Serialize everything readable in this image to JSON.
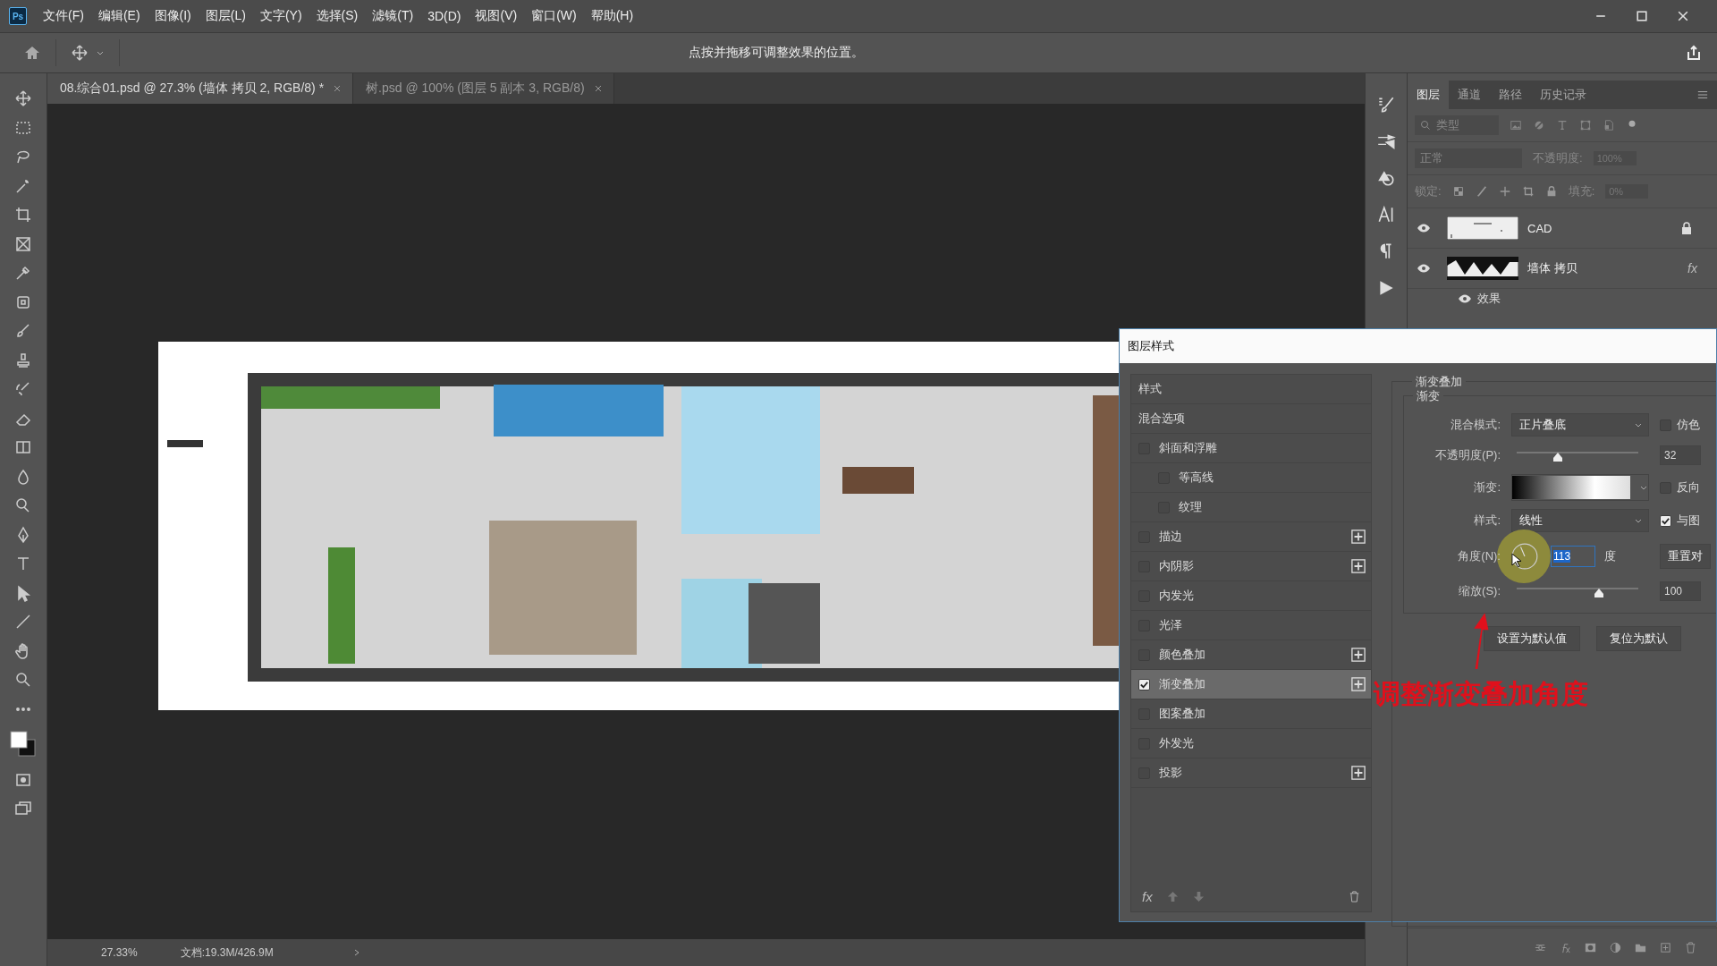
{
  "app_logo": "Ps",
  "menu_bar": {
    "items": [
      "文件(F)",
      "编辑(E)",
      "图像(I)",
      "图层(L)",
      "文字(Y)",
      "选择(S)",
      "滤镜(T)",
      "3D(D)",
      "视图(V)",
      "窗口(W)",
      "帮助(H)"
    ]
  },
  "options_bar": {
    "hint": "点按并拖移可调整效果的位置。"
  },
  "document_tabs": [
    {
      "label": "08.综合01.psd @ 27.3% (墙体 拷贝 2, RGB/8) *",
      "selected": true
    },
    {
      "label": "树.psd @ 100% (图层 5 副本 3, RGB/8)",
      "selected": false
    }
  ],
  "status_bar": {
    "zoom": "27.33%",
    "doc_info": "文档:19.3M/426.9M"
  },
  "layers_panel": {
    "tabs": [
      {
        "label": "图层",
        "selected": true
      },
      {
        "label": "通道",
        "selected": false
      },
      {
        "label": "路径",
        "selected": false
      },
      {
        "label": "历史记录",
        "selected": false
      }
    ],
    "filter": "类型",
    "blend_mode": "正常",
    "opacity_label": "不透明度:",
    "opacity": "100%",
    "lock_label": "锁定:",
    "fill_label": "填充:",
    "fill": "0%",
    "layers": [
      {
        "name": "CAD",
        "visible": true,
        "locked": true,
        "kind": "lines"
      },
      {
        "name": "墙体 拷贝",
        "visible": true,
        "locked": false,
        "kind": "walls",
        "badge": "fx",
        "effects_label": "效果"
      }
    ]
  },
  "layer_style_dialog": {
    "title": "图层样式",
    "styles": [
      {
        "label": "样式",
        "kind": "header",
        "selected": false
      },
      {
        "label": "混合选项",
        "kind": "header",
        "selected": false
      },
      {
        "label": "斜面和浮雕",
        "kind": "effect",
        "checked": false,
        "selected": false,
        "addable": false,
        "children": [
          {
            "label": "等高线",
            "kind": "effect",
            "checked": false,
            "selected": false,
            "addable": false
          },
          {
            "label": "纹理",
            "kind": "effect",
            "checked": false,
            "selected": false,
            "addable": false
          }
        ]
      },
      {
        "label": "描边",
        "kind": "effect",
        "checked": false,
        "selected": false,
        "addable": true
      },
      {
        "label": "内阴影",
        "kind": "effect",
        "checked": false,
        "selected": false,
        "addable": true
      },
      {
        "label": "内发光",
        "kind": "effect",
        "checked": false,
        "selected": false,
        "addable": false
      },
      {
        "label": "光泽",
        "kind": "effect",
        "checked": false,
        "selected": false,
        "addable": false
      },
      {
        "label": "颜色叠加",
        "kind": "effect",
        "checked": false,
        "selected": false,
        "addable": true
      },
      {
        "label": "渐变叠加",
        "kind": "effect",
        "checked": true,
        "selected": true,
        "addable": true
      },
      {
        "label": "图案叠加",
        "kind": "effect",
        "checked": false,
        "selected": false,
        "addable": false
      },
      {
        "label": "外发光",
        "kind": "effect",
        "checked": false,
        "selected": false,
        "addable": false
      },
      {
        "label": "投影",
        "kind": "effect",
        "checked": false,
        "selected": false,
        "addable": true
      }
    ],
    "footer_fx": "fx",
    "settings": {
      "title": "渐变叠加",
      "group": "渐变",
      "blend_mode_label": "混合模式:",
      "blend_mode": "正片叠底",
      "dither": {
        "label": "仿色",
        "checked": false
      },
      "opacity_label": "不透明度(P):",
      "opacity_slider": {
        "level": 0.32
      },
      "opacity": "32",
      "gradient_label": "渐变:",
      "reverse": {
        "label": "反向",
        "checked": false
      },
      "style_label": "样式:",
      "style": "线性",
      "align": {
        "label": "与图",
        "checked": true
      },
      "angle_label": "角度(N):",
      "angle": "113",
      "angle_unit": "度",
      "reset_align_button": "重置对",
      "scale_label": "缩放(S):",
      "scale_slider": {
        "level": 0.62
      },
      "scale": "100",
      "buttons": [
        "设置为默认值",
        "复位为默认"
      ]
    }
  },
  "annotation": {
    "text": "调整渐变叠加角度"
  }
}
